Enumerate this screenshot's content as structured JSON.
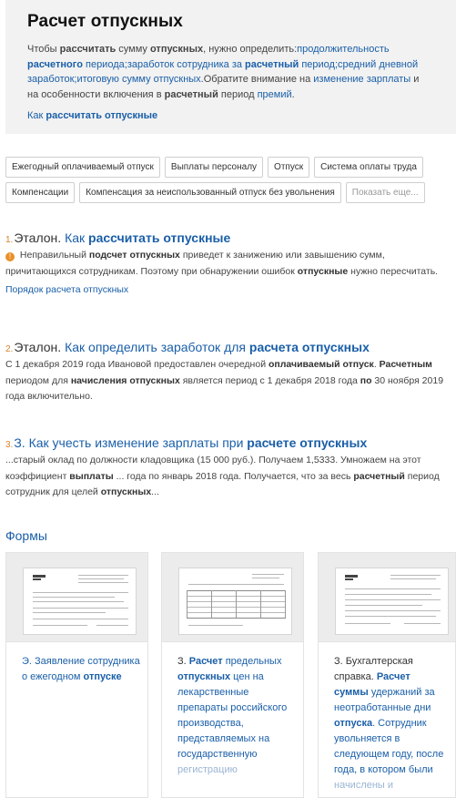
{
  "summary": {
    "title": "Расчет отпускных",
    "desc_parts": [
      {
        "t": "Чтобы ",
        "s": "n"
      },
      {
        "t": "рассчитать",
        "s": "b"
      },
      {
        "t": " сумму ",
        "s": "n"
      },
      {
        "t": "отпускных",
        "s": "b"
      },
      {
        "t": ", нужно определить:",
        "s": "n"
      },
      {
        "t": "продолжительность ",
        "s": "l"
      },
      {
        "t": "расчетного",
        "s": "lb"
      },
      {
        "t": " периода;",
        "s": "l"
      },
      {
        "t": "заработок сотрудника за ",
        "s": "l"
      },
      {
        "t": "расчетный",
        "s": "lb"
      },
      {
        "t": " период;",
        "s": "l"
      },
      {
        "t": "средний дневной заработок;",
        "s": "l"
      },
      {
        "t": "итоговую сумму отпускных.",
        "s": "l"
      },
      {
        "t": "Обратите внимание на ",
        "s": "n"
      },
      {
        "t": "изменение зарплаты",
        "s": "l"
      },
      {
        "t": " и на особенности включения в ",
        "s": "n"
      },
      {
        "t": "расчетный",
        "s": "b"
      },
      {
        "t": " период ",
        "s": "n"
      },
      {
        "t": "премий",
        "s": "l"
      },
      {
        "t": ".",
        "s": "n"
      }
    ],
    "how_prefix": "Как ",
    "how_bold": "рассчитать отпускные"
  },
  "tags": {
    "row1": [
      "Ежегодный оплачиваемый отпуск",
      "Выплаты персоналу",
      "Отпуск",
      "Система оплаты труда"
    ],
    "row2": [
      "Компенсации",
      "Компенсация за неиспользованный отпуск без увольнения"
    ],
    "more": "Показать еще..."
  },
  "results": [
    {
      "num": "1.",
      "prefix": "Эталон.",
      "title_parts": [
        {
          "t": " Как ",
          "s": "n"
        },
        {
          "t": "рассчитать отпускные",
          "s": "b"
        }
      ],
      "snippet_parts": [
        {
          "t": "!",
          "s": "icon"
        },
        {
          "t": " Неправильный ",
          "s": "n"
        },
        {
          "t": "подсчет отпускных",
          "s": "b"
        },
        {
          "t": " приведет к занижению или завышению сумм, причитающихся сотрудникам. Поэтому при обнаружении ошибок ",
          "s": "n"
        },
        {
          "t": "отпускные",
          "s": "b"
        },
        {
          "t": " нужно пересчитать.",
          "s": "n"
        }
      ],
      "sub": "Порядок расчета отпускных"
    },
    {
      "num": "2.",
      "prefix": "Эталон.",
      "title_parts": [
        {
          "t": " Как определить заработок для ",
          "s": "n"
        },
        {
          "t": "расчета отпускных",
          "s": "b"
        }
      ],
      "snippet_parts": [
        {
          "t": "С 1 декабря 2019 года Ивановой предоставлен очередной ",
          "s": "n"
        },
        {
          "t": "оплачиваемый отпуск",
          "s": "b"
        },
        {
          "t": ". ",
          "s": "n"
        },
        {
          "t": "Расчетным",
          "s": "b"
        },
        {
          "t": " периодом для ",
          "s": "n"
        },
        {
          "t": "начисления отпускных",
          "s": "b"
        },
        {
          "t": " является период с 1 декабря 2018 года ",
          "s": "n"
        },
        {
          "t": "по",
          "s": "b"
        },
        {
          "t": " 30 ноября 2019 года включительно.",
          "s": "n"
        }
      ],
      "sub": ""
    },
    {
      "num": "3.",
      "prefix": "З.",
      "title_parts": [
        {
          "t": " Как учесть изменение зарплаты при ",
          "s": "n"
        },
        {
          "t": "расчете отпускных",
          "s": "b"
        }
      ],
      "snippet_parts": [
        {
          "t": "...старый оклад по должности кладовщика (15 000 руб.). Получаем 1,5333. Умножаем на этот коэффициент ",
          "s": "n"
        },
        {
          "t": "выплаты",
          "s": "b"
        },
        {
          "t": " ... года по январь 2018 года. Получается, что за весь ",
          "s": "n"
        },
        {
          "t": "расчетный",
          "s": "b"
        },
        {
          "t": " период сотрудник для целей ",
          "s": "n"
        },
        {
          "t": "отпускных",
          "s": "b"
        },
        {
          "t": "...",
          "s": "n"
        }
      ],
      "sub": ""
    }
  ],
  "forms": {
    "heading": "Формы",
    "cards": [
      {
        "parts": [
          {
            "t": "Э. Заявление сотрудника о ежегодном ",
            "s": "n"
          },
          {
            "t": "отпуске",
            "s": "b"
          }
        ]
      },
      {
        "parts": [
          {
            "t": "З. ",
            "s": "g"
          },
          {
            "t": "Расчет",
            "s": "b"
          },
          {
            "t": " предельных ",
            "s": "n"
          },
          {
            "t": "отпускных",
            "s": "b"
          },
          {
            "t": " цен на лекарственные препараты российского производства, представляемых на государственную ",
            "s": "n"
          },
          {
            "t": "регистрацию",
            "s": "f"
          }
        ]
      },
      {
        "parts": [
          {
            "t": "З. Бухгалтерская справка. ",
            "s": "g"
          },
          {
            "t": "Расчет суммы",
            "s": "b"
          },
          {
            "t": " удержаний за неотработанные дни ",
            "s": "n"
          },
          {
            "t": "отпуска",
            "s": "b"
          },
          {
            "t": ". Сотрудник увольняется в следующем году, после года, в котором были ",
            "s": "n"
          },
          {
            "t": "начислены и",
            "s": "f"
          }
        ]
      }
    ]
  }
}
